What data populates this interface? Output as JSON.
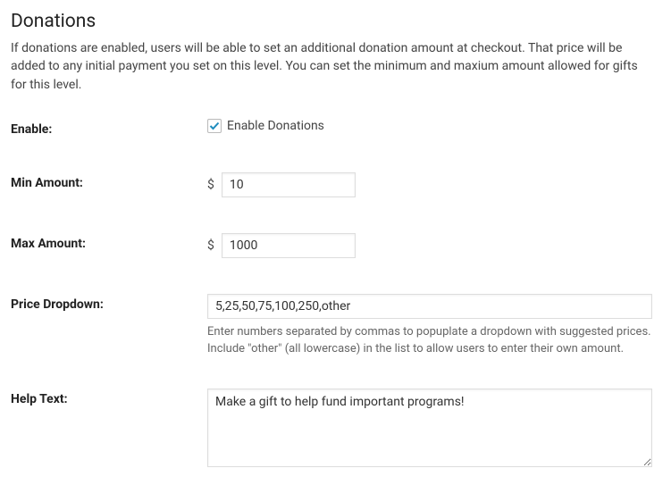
{
  "section": {
    "title": "Donations",
    "description": "If donations are enabled, users will be able to set an additional donation amount at checkout. That price will be added to any initial payment you set on this level. You can set the minimum and maxium amount allowed for gifts for this level."
  },
  "fields": {
    "enable": {
      "label": "Enable:",
      "checkbox_label": "Enable Donations",
      "checked": true
    },
    "min_amount": {
      "label": "Min Amount:",
      "currency": "$",
      "value": "10"
    },
    "max_amount": {
      "label": "Max Amount:",
      "currency": "$",
      "value": "1000"
    },
    "price_dropdown": {
      "label": "Price Dropdown:",
      "value": "5,25,50,75,100,250,other",
      "helper": "Enter numbers separated by commas to popuplate a dropdown with suggested prices. Include \"other\" (all lowercase) in the list to allow users to enter their own amount."
    },
    "help_text": {
      "label": "Help Text:",
      "value": "Make a gift to help fund important programs!"
    }
  },
  "colors": {
    "check": "#1e8cbe"
  }
}
